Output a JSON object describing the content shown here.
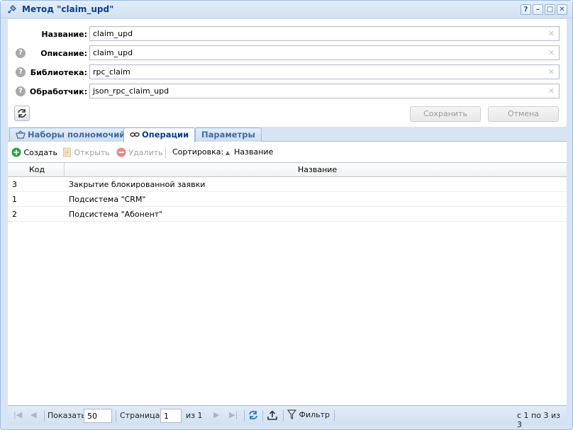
{
  "window": {
    "title": "Метод \"claim_upd\"",
    "title_icon": "method-icon",
    "tools": [
      "?",
      "–",
      "□",
      "✕"
    ]
  },
  "form": {
    "name_label": "Название:",
    "name_value": "claim_upd",
    "description_label": "Описание:",
    "description_value": "claim_upd",
    "library_label": "Библиотека:",
    "library_value": "rpc_claim",
    "handler_label": "Обработчик:",
    "handler_value": "json_rpc_claim_upd",
    "save_label": "Сохранить",
    "cancel_label": "Отмена"
  },
  "tabs": [
    {
      "label": "Наборы полномочий",
      "icon": "basket-icon"
    },
    {
      "label": "Операции",
      "icon": "link-icon",
      "active": true
    },
    {
      "label": "Параметры"
    }
  ],
  "toolbar": {
    "create": "Создать",
    "open": "Открыть",
    "delete": "Удалить",
    "sort_label": "Сортировка:",
    "sort_field": "Название"
  },
  "grid": {
    "columns": [
      "Код",
      "Название"
    ],
    "rows": [
      {
        "code": "3",
        "name": "Закрытие блокированной заявки"
      },
      {
        "code": "1",
        "name": "Подсистема \"CRM\""
      },
      {
        "code": "2",
        "name": "Подсистема \"Абонент\""
      }
    ]
  },
  "paging": {
    "show_label": "Показать",
    "page_size": "50",
    "page_label": "Страница",
    "page_value": "1",
    "of_label": "из 1",
    "filter_label": "Фильтр",
    "summary": "с 1 по 3 из 3"
  },
  "colors": {
    "accent": "#04408c",
    "frame": "#99bce8",
    "create_icon": "#2ea043",
    "delete_icon": "#e88a8a"
  }
}
